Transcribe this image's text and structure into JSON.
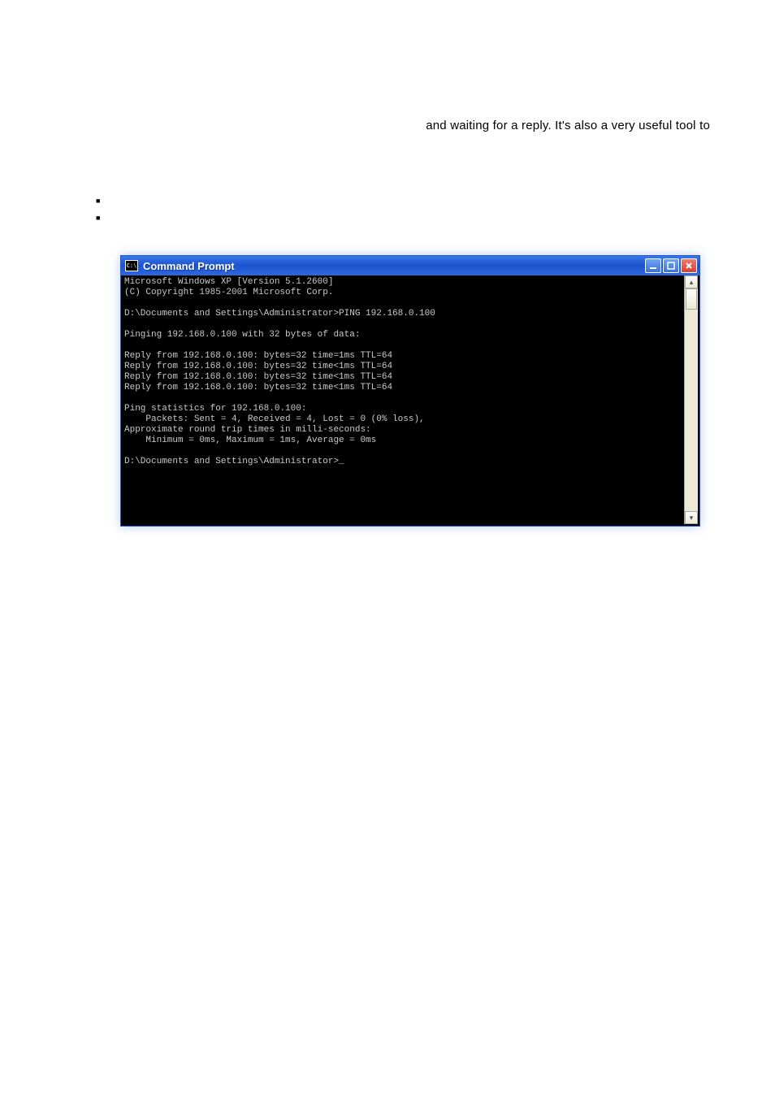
{
  "paragraph": {
    "fragment": "and waiting for a reply. It's also a very useful tool to"
  },
  "cmd": {
    "icon_text": "C:\\",
    "title": "Command Prompt",
    "minimize_glyph": "–",
    "close_glyph": "×",
    "scroll_up": "▴",
    "scroll_down": "▾",
    "lines": [
      "Microsoft Windows XP [Version 5.1.2600]",
      "(C) Copyright 1985-2001 Microsoft Corp.",
      "",
      "D:\\Documents and Settings\\Administrator>PING 192.168.0.100",
      "",
      "Pinging 192.168.0.100 with 32 bytes of data:",
      "",
      "Reply from 192.168.0.100: bytes=32 time=1ms TTL=64",
      "Reply from 192.168.0.100: bytes=32 time<1ms TTL=64",
      "Reply from 192.168.0.100: bytes=32 time<1ms TTL=64",
      "Reply from 192.168.0.100: bytes=32 time<1ms TTL=64",
      "",
      "Ping statistics for 192.168.0.100:",
      "    Packets: Sent = 4, Received = 4, Lost = 0 (0% loss),",
      "Approximate round trip times in milli-seconds:",
      "    Minimum = 0ms, Maximum = 1ms, Average = 0ms",
      "",
      "D:\\Documents and Settings\\Administrator>_"
    ]
  }
}
